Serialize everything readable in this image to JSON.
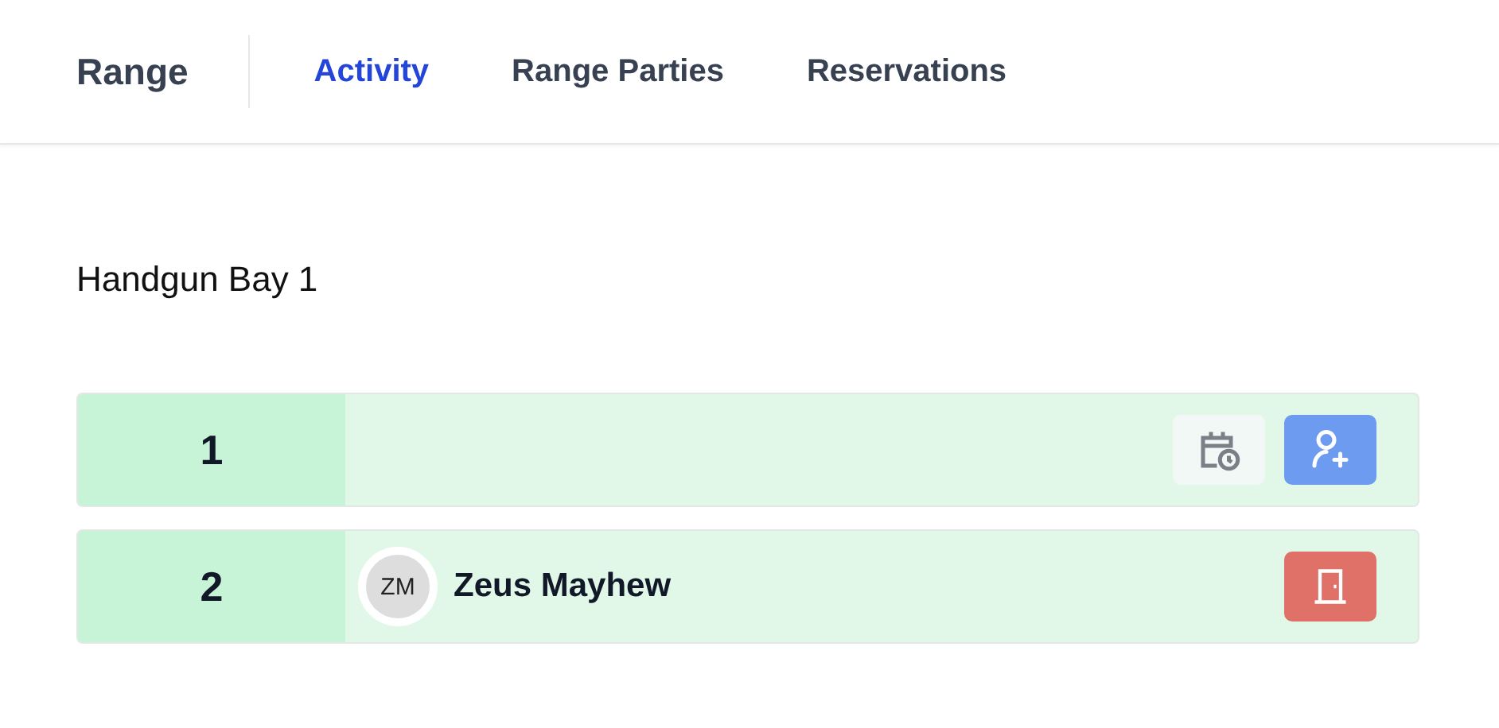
{
  "brand": "Range",
  "tabs": [
    {
      "label": "Activity",
      "selected": true
    },
    {
      "label": "Range Parties",
      "selected": false
    },
    {
      "label": "Reservations",
      "selected": false
    }
  ],
  "bay": {
    "title": "Handgun Bay 1",
    "lanes": [
      {
        "number": "1",
        "actions": [
          {
            "kind": "schedule"
          },
          {
            "kind": "add-shooter"
          }
        ]
      },
      {
        "number": "2",
        "shooter": {
          "initials": "ZM",
          "name": "Zeus Mayhew"
        },
        "actions": [
          {
            "kind": "checkout"
          }
        ]
      }
    ]
  }
}
